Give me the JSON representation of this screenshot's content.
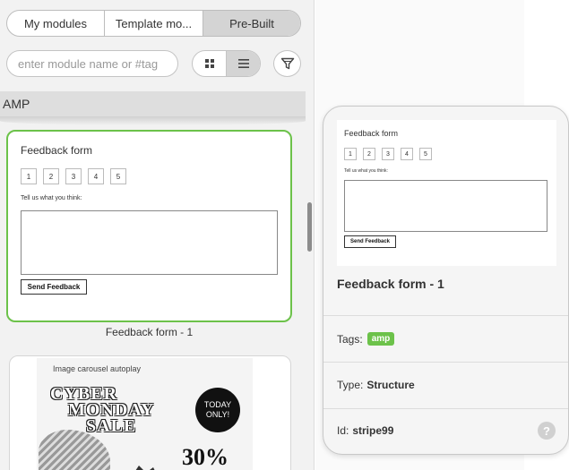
{
  "tabs": [
    {
      "label": "My modules",
      "active": false
    },
    {
      "label": "Template mo...",
      "active": false
    },
    {
      "label": "Pre-Built",
      "active": true
    }
  ],
  "search": {
    "placeholder": "enter module name or #tag"
  },
  "view_toggle": {
    "grid_icon": "grid-icon",
    "list_icon": "list-icon",
    "active": "list"
  },
  "filter": {
    "icon": "funnel-icon"
  },
  "section": {
    "title": "AMP"
  },
  "modules": [
    {
      "name": "Feedback form - 1",
      "preview": {
        "title": "Feedback form",
        "ratings": [
          "1",
          "2",
          "3",
          "4",
          "5"
        ],
        "prompt": "Tell us what you think:",
        "button": "Send Feedback"
      },
      "selected": true
    },
    {
      "name": "Image carousel autoplay",
      "preview": {
        "title": "Image carousel autoplay",
        "headline": [
          "CYBER",
          "MONDAY",
          "SALE"
        ],
        "badge": [
          "TODAY",
          "ONLY!"
        ],
        "discount": "30%"
      },
      "selected": false
    }
  ],
  "details": {
    "name": "Feedback form - 1",
    "preview": {
      "title": "Feedback form",
      "ratings": [
        "1",
        "2",
        "3",
        "4",
        "5"
      ],
      "prompt": "Tell us what you think:",
      "button": "Send Feedback"
    },
    "tags_label": "Tags:",
    "tag": "amp",
    "type_label": "Type:",
    "type_value": "Structure",
    "id_label": "Id:",
    "id_value": "stripe99",
    "help": "?"
  },
  "colors": {
    "accent_green": "#6cc24a",
    "panel_bg": "#f2f2f2",
    "active_tab_bg": "#d4d4d4"
  }
}
